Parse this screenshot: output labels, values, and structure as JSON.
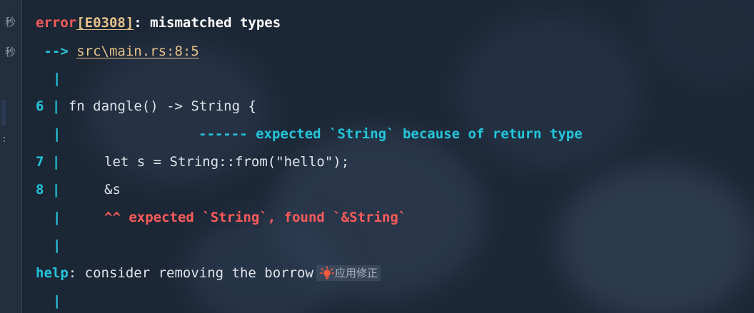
{
  "gutter": {
    "items": [
      "秒",
      "秒",
      ":"
    ]
  },
  "error": {
    "keyword": "error",
    "code": "[E0308]",
    "message": ": mismatched types"
  },
  "location": {
    "arrow": " -->",
    "path": "src\\main.rs:8:5"
  },
  "lines": {
    "pipe": "|",
    "l6_num": "6",
    "l6_code": "fn dangle() -> String {",
    "l6_note": "------ expected `String` because of return type",
    "l7_num": "7",
    "l7_code": "let s = String::from(\"hello\");",
    "l8_num": "8",
    "l8_code": "&s",
    "l8_note": "^^ expected `String`, found `&String`"
  },
  "help": {
    "keyword": "help",
    "message": ": consider removing the borrow"
  },
  "quickfix": {
    "label": "应用修正",
    "icon": "lightbulb-icon"
  },
  "colors": {
    "error": "#ff5b5b",
    "info": "#23c6dc",
    "link": "#e7c28a",
    "background": "#1c2736"
  }
}
